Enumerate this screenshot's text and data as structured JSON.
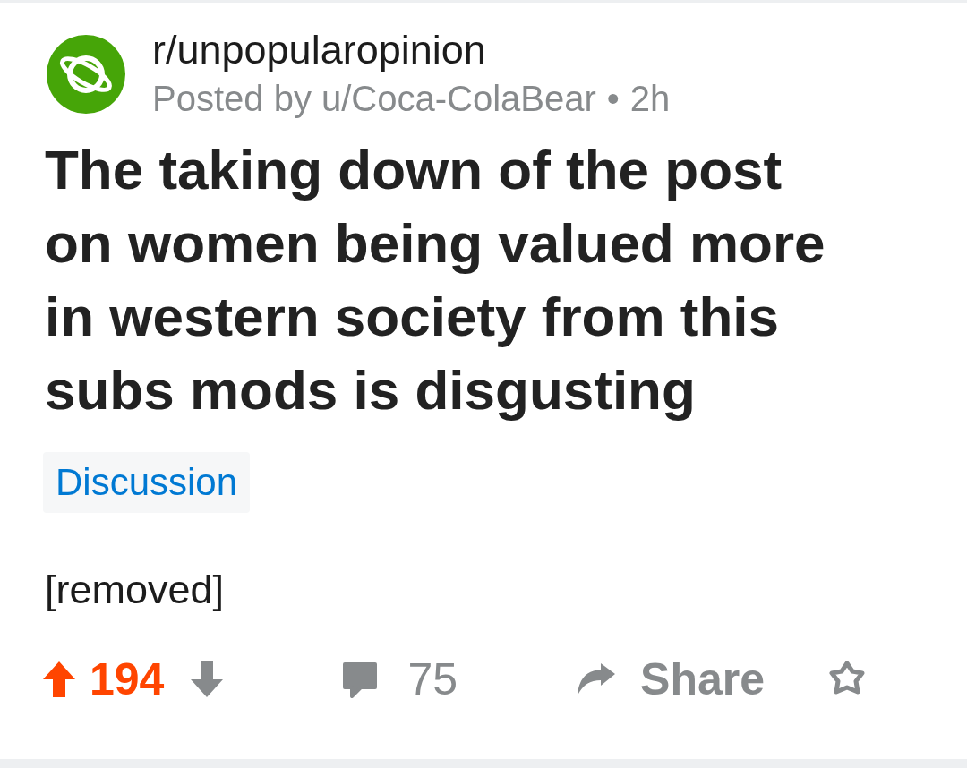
{
  "post": {
    "subreddit": "r/unpopularopinion",
    "posted_by": "Posted by u/Coca-ColaBear",
    "separator": "•",
    "age": "2h",
    "title": "The taking down of the post on women being valued more in western society from this subs mods is disgusting",
    "flair": "Discussion",
    "body": "[removed]"
  },
  "actions": {
    "upvoted": true,
    "score": "194",
    "comments": "75",
    "share": "Share"
  }
}
